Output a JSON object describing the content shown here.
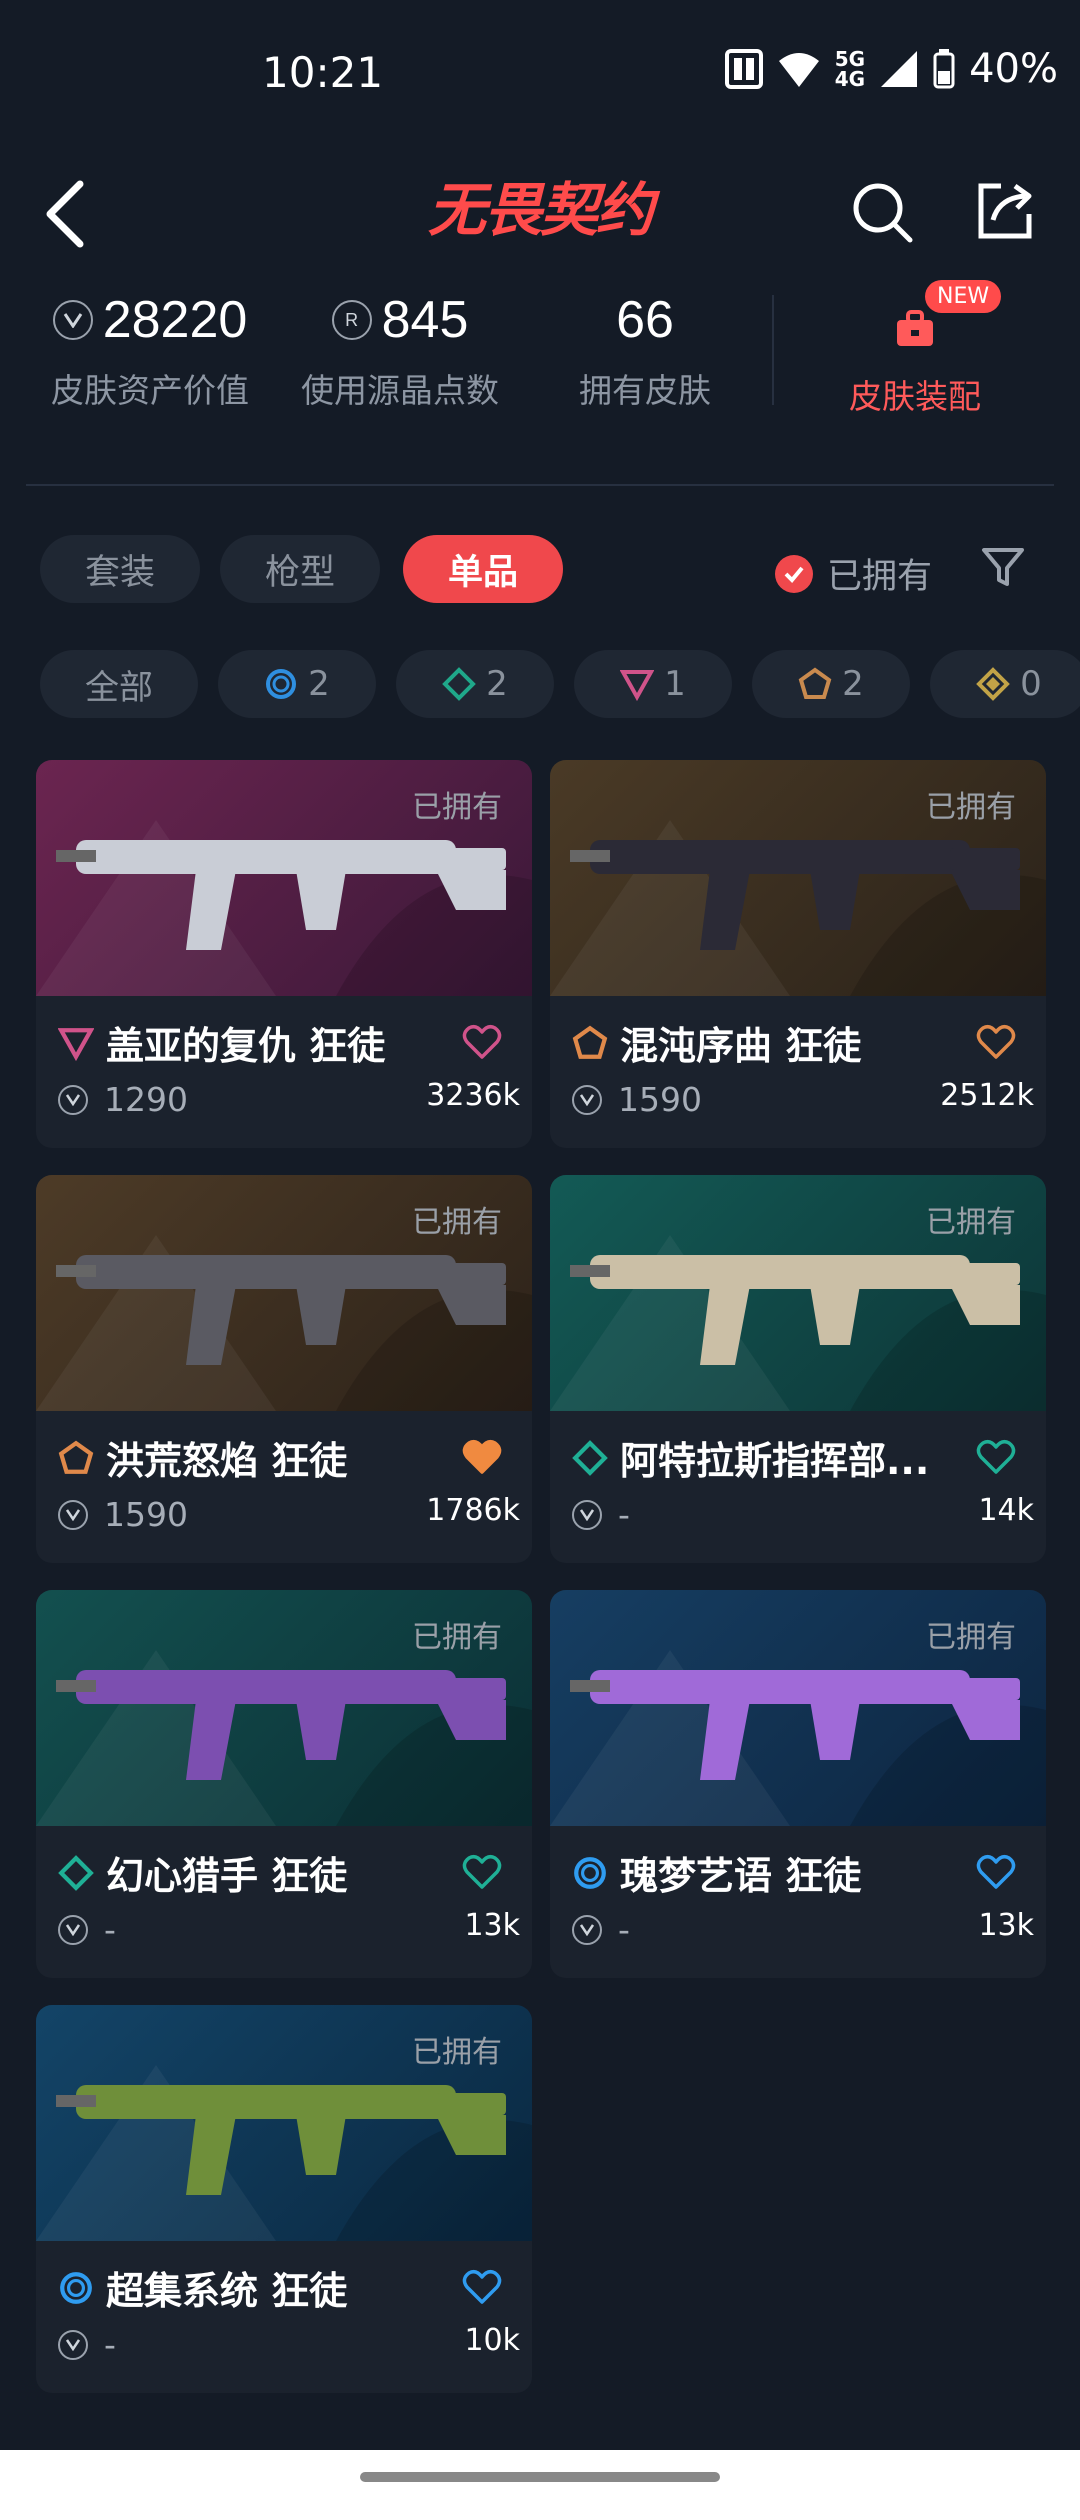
{
  "status": {
    "time": "10:21",
    "network_top": "5G",
    "network_bottom": "4G",
    "battery": "40%"
  },
  "header": {
    "brand": "无畏契约"
  },
  "stats": {
    "asset_value": "28220",
    "asset_value_label": "皮肤资产价值",
    "radianite": "845",
    "radianite_label": "使用源晶点数",
    "owned_count": "66",
    "owned_count_label": "拥有皮肤",
    "equip_label": "皮肤装配",
    "new_badge": "NEW"
  },
  "tabs": [
    {
      "label": "套装"
    },
    {
      "label": "枪型"
    },
    {
      "label": "单品"
    }
  ],
  "owned_filter_label": "已拥有",
  "rarity_filters": [
    {
      "label": "全部"
    },
    {
      "count": "2",
      "icon": "select-tier-icon",
      "color": "#2f8fe0"
    },
    {
      "count": "2",
      "icon": "deluxe-tier-icon",
      "color": "#1fa88a"
    },
    {
      "count": "1",
      "icon": "premium-tier-icon",
      "color": "#d0538a"
    },
    {
      "count": "2",
      "icon": "exclusive-tier-icon",
      "color": "#c98a4e"
    },
    {
      "count": "0",
      "icon": "ultra-tier-icon",
      "color": "#c2a347"
    }
  ],
  "skins": [
    {
      "name": "盖亚的复仇 狂徒",
      "price": "1290",
      "likes": "3236k",
      "owned": "已拥有",
      "tier_color": "#d0538a",
      "heart_color": "#d0538a",
      "heart_filled": false
    },
    {
      "name": "混沌序曲 狂徒",
      "price": "1590",
      "likes": "2512k",
      "owned": "已拥有",
      "tier_color": "#e0894a",
      "heart_color": "#e0894a",
      "heart_filled": false
    },
    {
      "name": "洪荒怒焰 狂徒",
      "price": "1590",
      "likes": "1786k",
      "owned": "已拥有",
      "tier_color": "#e0894a",
      "heart_color": "#f08a40",
      "heart_filled": true
    },
    {
      "name": "阿特拉斯指挥部...",
      "price": "-",
      "likes": "14k",
      "owned": "已拥有",
      "tier_color": "#1fb096",
      "heart_color": "#1fb096",
      "heart_filled": false
    },
    {
      "name": "幻心猎手 狂徒",
      "price": "-",
      "likes": "13k",
      "owned": "已拥有",
      "tier_color": "#1fb096",
      "heart_color": "#1fb096",
      "heart_filled": false
    },
    {
      "name": "瑰梦艺语 狂徒",
      "price": "-",
      "likes": "13k",
      "owned": "已拥有",
      "tier_color": "#2f9cf0",
      "heart_color": "#2f9cf0",
      "heart_filled": false
    },
    {
      "name": "超集系统 狂徒",
      "price": "-",
      "likes": "10k",
      "owned": "已拥有",
      "tier_color": "#2f9cf0",
      "heart_color": "#2f9cf0",
      "heart_filled": false
    }
  ]
}
